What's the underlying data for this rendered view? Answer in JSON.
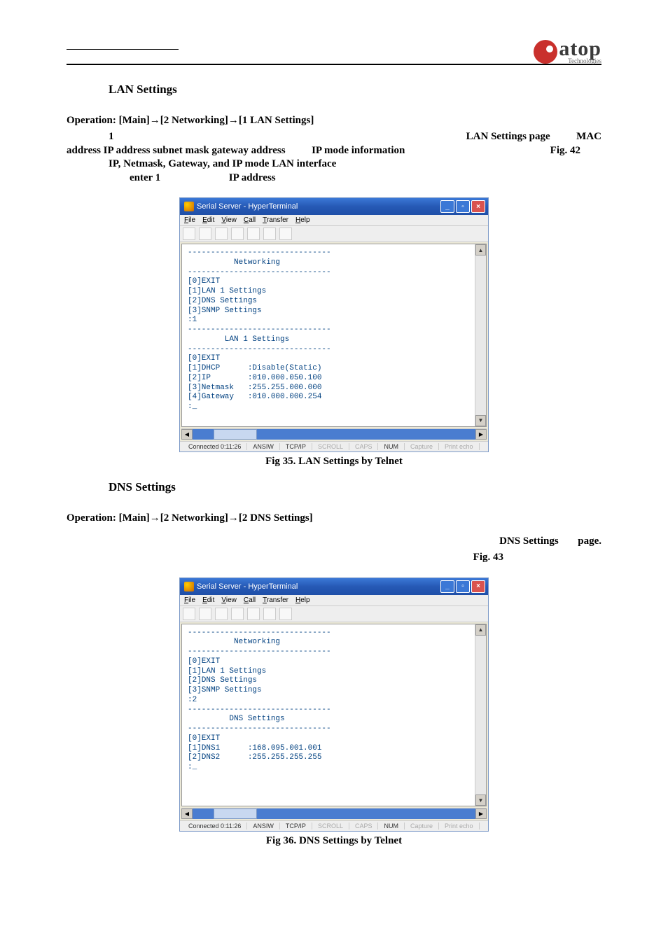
{
  "logo": {
    "main": "atop",
    "sub": "Technologies"
  },
  "section1": {
    "title": "LAN Settings",
    "operation_prefix": "Operation: ",
    "operation_main": "[Main]",
    "operation_net": "[2 Networking]",
    "operation_lan": "[1 LAN Settings]",
    "para_l1_left": "1",
    "para_l1_right_a": "LAN Settings page",
    "para_l1_right_b": "MAC",
    "para_l2_left": "address  IP address  subnet mask  gateway address",
    "para_l2_mid": "IP mode information",
    "para_l2_right": "Fig. 42",
    "para_l3": "IP, Netmask, Gateway, and IP mode      LAN interface",
    "para_l4_a": "enter 1",
    "para_l4_b": "IP address"
  },
  "terminal1": {
    "title": "Serial Server - HyperTerminal",
    "menu": {
      "file": "File",
      "edit": "Edit",
      "view": "View",
      "call": "Call",
      "transfer": "Transfer",
      "help": "Help"
    },
    "content": "-------------------------------\n          Networking\n-------------------------------\n[0]EXIT\n[1]LAN 1 Settings\n[2]DNS Settings\n[3]SNMP Settings\n:1\n-------------------------------\n        LAN 1 Settings\n-------------------------------\n[0]EXIT\n[1]DHCP      :Disable(Static)\n[2]IP        :010.000.050.100\n[3]Netmask   :255.255.000.000\n[4]Gateway   :010.000.000.254\n:_\n\n",
    "status": {
      "conn": "Connected 0:11:26",
      "emul": "ANSIW",
      "proto": "TCP/IP",
      "scroll": "SCROLL",
      "caps": "CAPS",
      "num": "NUM",
      "capture": "Capture",
      "echo": "Print echo"
    }
  },
  "fig1": "Fig 35. LAN Settings by Telnet",
  "section2": {
    "title": "DNS Settings",
    "operation_prefix": "Operation: ",
    "operation_main": "[Main]",
    "operation_net": "[2 Networking]",
    "operation_dns": "[2 DNS Settings]",
    "r1_a": "DNS Settings",
    "r1_b": "page.",
    "r2": "Fig. 43"
  },
  "terminal2": {
    "title": "Serial Server - HyperTerminal",
    "content": "-------------------------------\n          Networking\n-------------------------------\n[0]EXIT\n[1]LAN 1 Settings\n[2]DNS Settings\n[3]SNMP Settings\n:2\n-------------------------------\n         DNS Settings\n-------------------------------\n[0]EXIT\n[1]DNS1      :168.095.001.001\n[2]DNS2      :255.255.255.255\n:_\n\n\n\n",
    "status": {
      "conn": "Connected 0:11:26",
      "emul": "ANSIW",
      "proto": "TCP/IP",
      "scroll": "SCROLL",
      "caps": "CAPS",
      "num": "NUM",
      "capture": "Capture",
      "echo": "Print echo"
    }
  },
  "fig2": "Fig 36. DNS Settings by Telnet"
}
